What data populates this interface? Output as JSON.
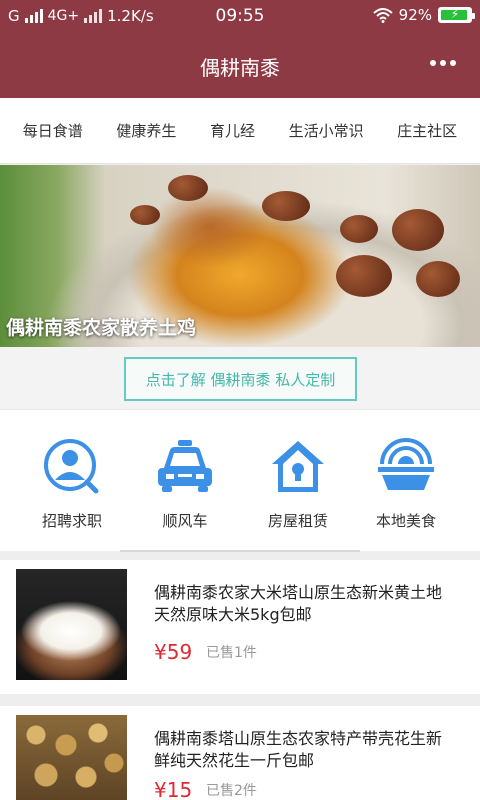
{
  "status": {
    "carrier": "G",
    "network": "4G+",
    "speed": "1.2K/s",
    "time": "09:55",
    "battery": "92%",
    "battery_level": 0.92
  },
  "header": {
    "title": "偶耕南黍",
    "more_icon": "more-dots-icon"
  },
  "categories": [
    "每日食谱",
    "健康养生",
    "育儿经",
    "生活小常识",
    "庄主社区"
  ],
  "banner": {
    "caption": "偶耕南黍农家散养土鸡"
  },
  "promo": {
    "label": "点击了解 偶耕南黍 私人定制"
  },
  "services": [
    {
      "label": "招聘求职",
      "icon": "job-person-icon"
    },
    {
      "label": "顺风车",
      "icon": "car-icon"
    },
    {
      "label": "房屋租赁",
      "icon": "house-lock-icon"
    },
    {
      "label": "本地美食",
      "icon": "food-bowl-icon"
    }
  ],
  "products": [
    {
      "name": "偶耕南黍农家大米塔山原生态新米黄土地天然原味大米5kg包邮",
      "price": "¥59",
      "sold": "已售1件"
    },
    {
      "name": "偶耕南黍塔山原生态农家特产带壳花生新鲜纯天然花生一斤包邮",
      "price": "¥15",
      "sold": "已售2件"
    }
  ],
  "colors": {
    "brand": "#8e3a45",
    "accent": "#45b8a8",
    "price": "#e02933",
    "icon": "#3c91e6"
  }
}
